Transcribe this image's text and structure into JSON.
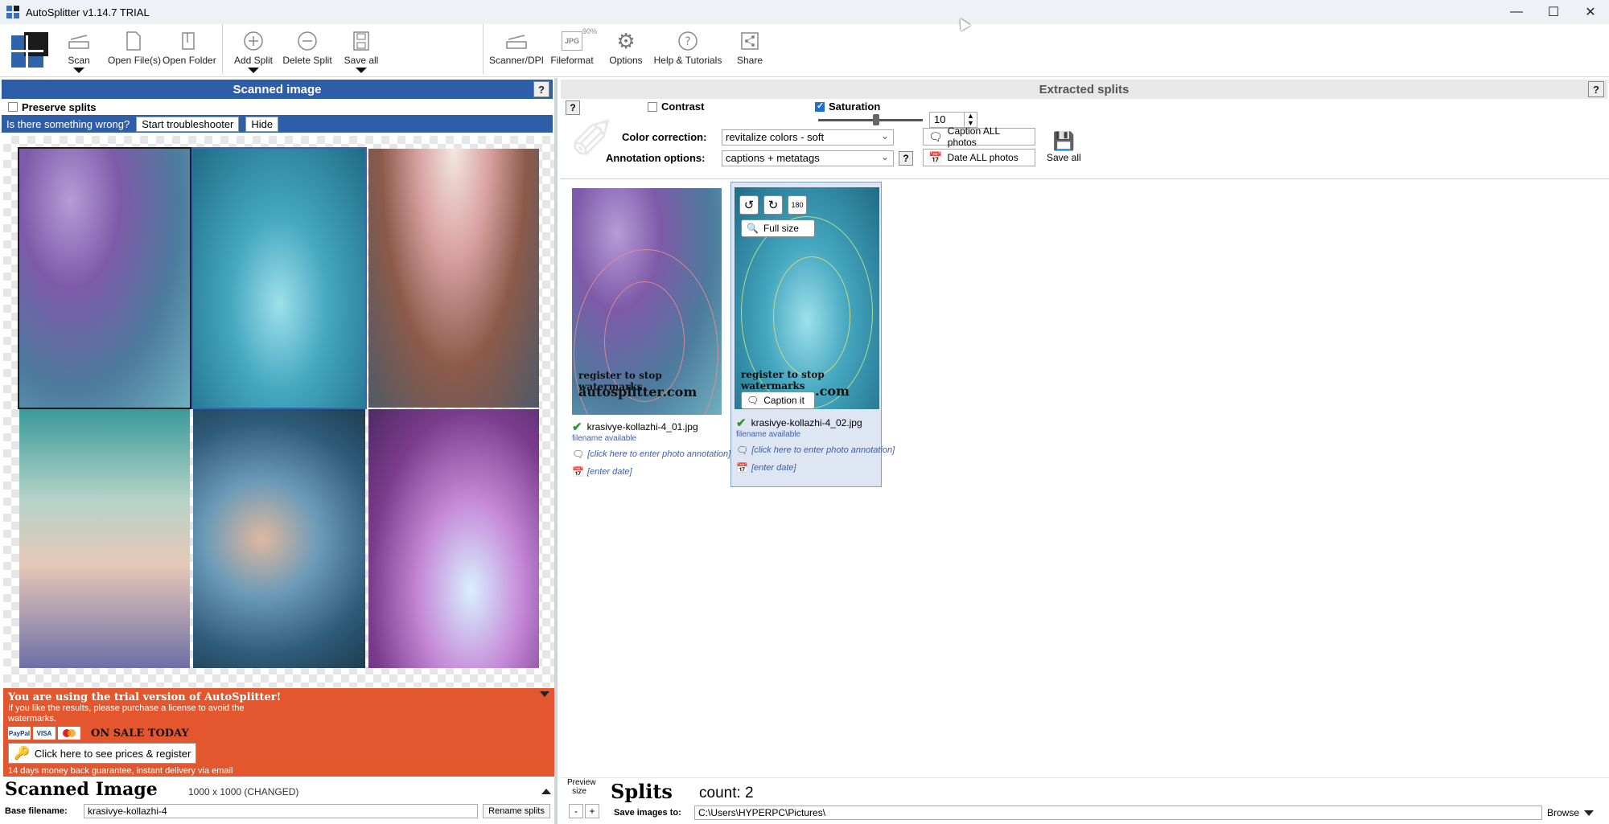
{
  "window": {
    "title": "AutoSplitter v1.14.7 TRIAL"
  },
  "toolbar": {
    "scan": "Scan",
    "open_files": "Open File(s)",
    "open_folder": "Open Folder",
    "add_split": "Add Split",
    "delete_split": "Delete Split",
    "save_all": "Save all",
    "scanner_dpi": "Scanner/DPI",
    "fileformat": "Fileformat",
    "fileformat_badge": "90%",
    "fileformat_icon_text": "JPG",
    "options": "Options",
    "help": "Help & Tutorials",
    "share": "Share"
  },
  "left": {
    "header": "Scanned image",
    "help": "?",
    "preserve_splits": "Preserve splits",
    "trouble_text": "Is there something wrong?",
    "trouble_btn": "Start troubleshooter",
    "hide_btn": "Hide",
    "promo": {
      "heading": "You are using the trial version of AutoSplitter!",
      "text": "If you like the results, please purchase a license to avoid the watermarks.",
      "card_paypal": "PayPal",
      "card_visa": "VISA",
      "sale": "ON SALE TODAY",
      "register_btn": "Click here to see prices & register",
      "footer": "14 days money back guarantee, instant delivery via email"
    },
    "bottom": {
      "title": "Scanned Image",
      "dims": "1000 x 1000 (CHANGED)",
      "base_label": "Base filename:",
      "base_value": "krasivye-kollazhi-4",
      "rename_btn": "Rename splits"
    }
  },
  "right": {
    "header": "Extracted splits",
    "help": "?",
    "contrast": "Contrast",
    "saturation": "Saturation",
    "saturation_value": "10",
    "color_label": "Color correction:",
    "color_value": "revitalize colors - soft",
    "annot_label": "Annotation options:",
    "annot_value": "captions + metatags",
    "caption_all": "Caption ALL photos",
    "date_all": "Date ALL photos",
    "save_all": "Save all",
    "splits": [
      {
        "filename": "krasivye-kollazhi-4_01.jpg",
        "status": "filename available",
        "annotation": "[click here to enter photo annotation]",
        "date": "[enter date]",
        "wm1": "register to stop watermarks",
        "wm2": "autosplitter.com"
      },
      {
        "filename": "krasivye-kollazhi-4_02.jpg",
        "status": "filename available",
        "annotation": "[click here to enter photo annotation]",
        "date": "[enter date]",
        "wm1": "register to stop watermarks",
        "wm2": ".com",
        "full_size": "Full size",
        "caption_it": "Caption it"
      }
    ],
    "bottom": {
      "preview_size": "Preview size",
      "minus": "-",
      "plus": "+",
      "title": "Splits",
      "count": "count: 2",
      "save_label": "Save images to:",
      "save_path": "C:\\Users\\HYPERPC\\Pictures\\",
      "browse": "Browse"
    }
  },
  "colors": {
    "accent_blue": "#2e5ea8",
    "promo_orange": "#e4572e",
    "check_green": "#2a9a2a"
  }
}
